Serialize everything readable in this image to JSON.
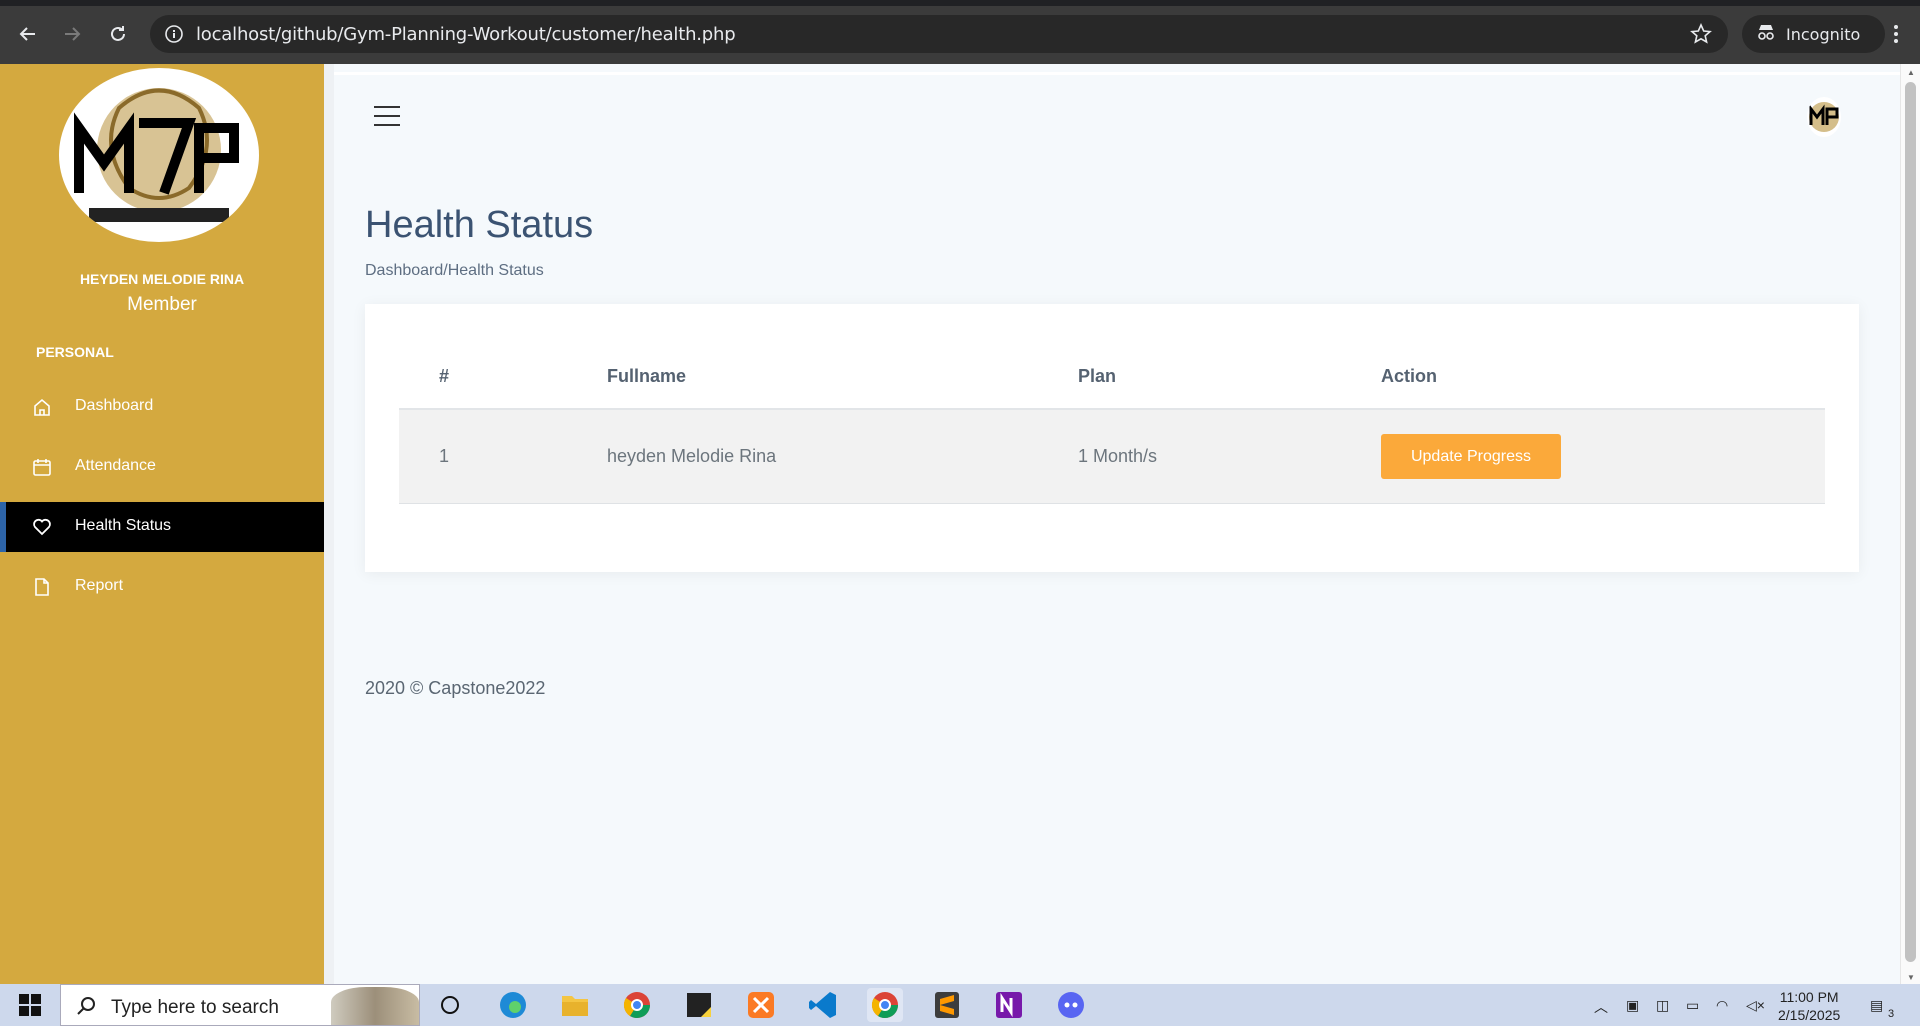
{
  "browser": {
    "url": "localhost/github/Gym-Planning-Workout/customer/health.php",
    "incognito_label": "Incognito"
  },
  "sidebar": {
    "user_name": "HEYDEN MELODIE RINA",
    "user_role": "Member",
    "section_label": "PERSONAL",
    "items": [
      {
        "label": "Dashboard",
        "icon": "home-icon",
        "active": false
      },
      {
        "label": "Attendance",
        "icon": "calendar-icon",
        "active": false
      },
      {
        "label": "Health Status",
        "icon": "heart-icon",
        "active": true
      },
      {
        "label": "Report",
        "icon": "file-icon",
        "active": false
      }
    ]
  },
  "main": {
    "page_title": "Health Status",
    "breadcrumb": "Dashboard/Health Status",
    "table": {
      "headers": [
        "#",
        "Fullname",
        "Plan",
        "Action"
      ],
      "rows": [
        {
          "num": "1",
          "fullname": "heyden Melodie Rina",
          "plan": "1 Month/s",
          "action_label": "Update Progress"
        }
      ]
    },
    "footer": "2020 © Capstone2022"
  },
  "taskbar": {
    "search_placeholder": "Type here to search",
    "time": "11:00 PM",
    "date": "2/15/2025",
    "notification_count": "3"
  },
  "colors": {
    "sidebar_bg": "#d4a93f",
    "active_item_bg": "#000000",
    "accent_button": "#fba93a",
    "title_color": "#3b5372"
  }
}
